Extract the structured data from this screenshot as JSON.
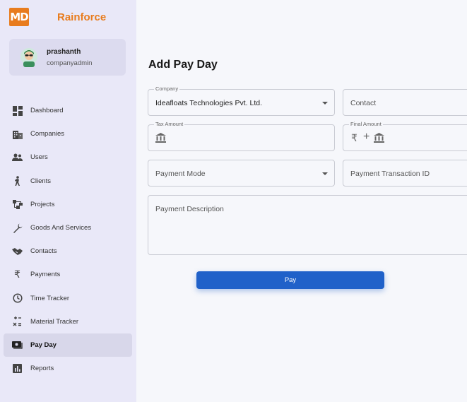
{
  "app": {
    "logo_text": "MD",
    "brand": "Rainforce"
  },
  "profile": {
    "name": "prashanth",
    "role": "companyadmin"
  },
  "sidebar": {
    "items": [
      {
        "label": "Dashboard",
        "icon": "dashboard-icon"
      },
      {
        "label": "Companies",
        "icon": "building-icon"
      },
      {
        "label": "Users",
        "icon": "users-icon"
      },
      {
        "label": "Clients",
        "icon": "person-walking-icon"
      },
      {
        "label": "Projects",
        "icon": "hierarchy-icon"
      },
      {
        "label": "Goods And Services",
        "icon": "wrench-icon"
      },
      {
        "label": "Contacts",
        "icon": "handshake-icon"
      },
      {
        "label": "Payments",
        "icon": "rupee-icon"
      },
      {
        "label": "Time Tracker",
        "icon": "clock-icon"
      },
      {
        "label": "Material Tracker",
        "icon": "material-icon"
      },
      {
        "label": "Pay Day",
        "icon": "payday-icon",
        "active": true
      },
      {
        "label": "Reports",
        "icon": "reports-icon"
      }
    ]
  },
  "main": {
    "title": "Add Pay Day",
    "company": {
      "label": "Company",
      "value": "Ideafloats Technologies Pvt. Ltd."
    },
    "contact": {
      "placeholder": "Contact"
    },
    "tax_amount": {
      "label": "Tax Amount"
    },
    "final_amount": {
      "label": "Final Amount"
    },
    "payment_mode": {
      "placeholder": "Payment Mode"
    },
    "payment_transaction_id": {
      "placeholder": "Payment Transaction ID"
    },
    "payment_description": {
      "placeholder": "Payment Description"
    },
    "pay_button": "Pay"
  },
  "colors": {
    "brand_orange": "#e87c1e",
    "primary_blue": "#2061c9",
    "sidebar_bg": "#e9e8f8"
  }
}
